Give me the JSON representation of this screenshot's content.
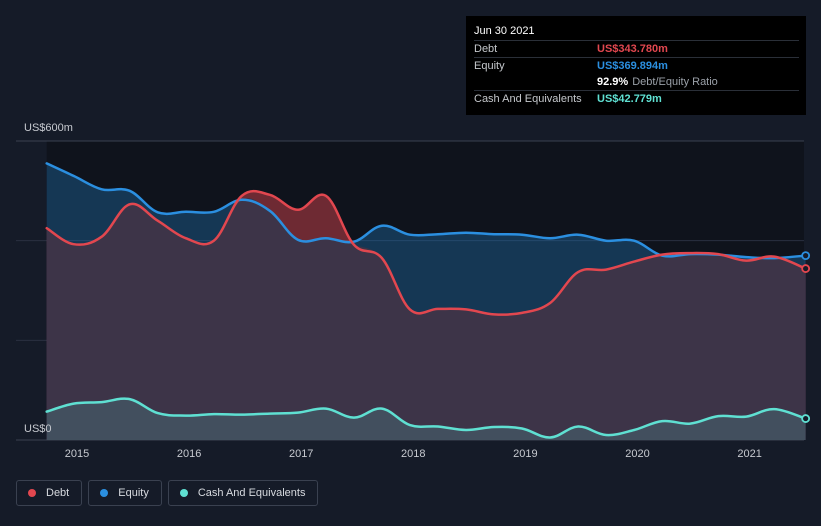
{
  "tooltip": {
    "date": "Jun 30 2021",
    "debt_label": "Debt",
    "debt_value": "US$343.780m",
    "equity_label": "Equity",
    "equity_value": "US$369.894m",
    "ratio_value": "92.9%",
    "ratio_label": "Debt/Equity Ratio",
    "cash_label": "Cash And Equivalents",
    "cash_value": "US$42.779m"
  },
  "legend": {
    "debt": "Debt",
    "equity": "Equity",
    "cash": "Cash And Equivalents"
  },
  "colors": {
    "debt": "#e2474f",
    "equity": "#2b8fe0",
    "cash": "#5fe0d2",
    "background": "#151b28"
  },
  "chart_data": {
    "type": "area",
    "ylim": [
      0,
      600
    ],
    "y_tick_labels": [
      "US$0",
      "US$600m"
    ],
    "x_ticks": [
      2015,
      2016,
      2017,
      2018,
      2019,
      2020,
      2021
    ],
    "x_range": [
      2014.73,
      2021.5
    ],
    "grid": true,
    "legend_position": "bottom-left",
    "series": [
      {
        "name": "Debt",
        "x": [
          2014.73,
          2014.97,
          2015.22,
          2015.47,
          2015.72,
          2015.97,
          2016.22,
          2016.47,
          2016.72,
          2016.97,
          2017.22,
          2017.47,
          2017.72,
          2017.97,
          2018.22,
          2018.47,
          2018.72,
          2018.97,
          2019.22,
          2019.47,
          2019.72,
          2019.97,
          2020.22,
          2020.47,
          2020.72,
          2020.97,
          2021.22,
          2021.5
        ],
        "values": [
          425,
          393,
          408,
          473,
          440,
          405,
          400,
          490,
          492,
          462,
          490,
          392,
          365,
          262,
          263,
          262,
          252,
          255,
          275,
          337,
          342,
          358,
          372,
          375,
          373,
          360,
          368,
          344
        ]
      },
      {
        "name": "Equity",
        "x": [
          2014.73,
          2014.97,
          2015.22,
          2015.47,
          2015.72,
          2015.97,
          2016.22,
          2016.47,
          2016.72,
          2016.97,
          2017.22,
          2017.47,
          2017.72,
          2017.97,
          2018.22,
          2018.47,
          2018.72,
          2018.97,
          2019.22,
          2019.47,
          2019.72,
          2019.97,
          2020.22,
          2020.47,
          2020.72,
          2020.97,
          2021.22,
          2021.5
        ],
        "values": [
          555,
          530,
          503,
          500,
          457,
          458,
          458,
          482,
          460,
          402,
          405,
          398,
          430,
          412,
          413,
          416,
          413,
          412,
          405,
          412,
          400,
          400,
          370,
          373,
          372,
          367,
          365,
          370
        ]
      },
      {
        "name": "Cash And Equivalents",
        "x": [
          2014.73,
          2014.97,
          2015.22,
          2015.47,
          2015.72,
          2015.97,
          2016.22,
          2016.47,
          2016.72,
          2016.97,
          2017.22,
          2017.47,
          2017.72,
          2017.97,
          2018.22,
          2018.47,
          2018.72,
          2018.97,
          2019.22,
          2019.47,
          2019.72,
          2019.97,
          2020.22,
          2020.47,
          2020.72,
          2020.97,
          2021.22,
          2021.5
        ],
        "values": [
          57,
          73,
          76,
          82,
          54,
          49,
          52,
          51,
          53,
          55,
          63,
          45,
          63,
          30,
          27,
          20,
          26,
          23,
          5,
          27,
          10,
          20,
          38,
          33,
          48,
          47,
          62,
          43
        ]
      }
    ]
  }
}
